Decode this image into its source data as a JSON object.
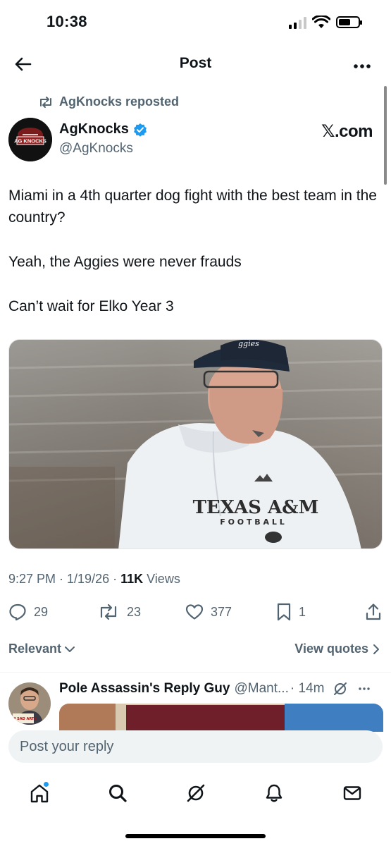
{
  "status_bar": {
    "time": "10:38"
  },
  "header": {
    "title": "Post",
    "more_icon": "more-icon"
  },
  "repost": {
    "text": "AgKnocks reposted"
  },
  "author": {
    "name": "AgKnocks",
    "handle": "@AgKnocks",
    "verified": true,
    "avatar_text": "AG KNOCKS",
    "source_label": "𝕏.com"
  },
  "post": {
    "paragraphs": [
      "Miami in a 4th quarter dog fight with the best team in the country?",
      "Yeah, the Aggies were never frauds",
      "Can’t wait for Elko Year 3"
    ],
    "image": {
      "shirt_line1": "TEXAS A&M",
      "shirt_line2": "F O O T B A L L"
    }
  },
  "meta": {
    "time_date": "9:27 PM · 1/19/26 · ",
    "views_count": "11K",
    "views_label": " Views"
  },
  "actions": {
    "replies": "29",
    "reposts": "23",
    "likes": "377",
    "bookmarks": "1"
  },
  "sort": {
    "label": "Relevant",
    "view_quotes": "View quotes"
  },
  "reply": {
    "name": "Pole Assassin's Reply Guy",
    "handle": "@Mant...",
    "time": "· 14m",
    "avatar_caption": "I'M SAD ARTY"
  },
  "composer": {
    "placeholder": "Post your reply"
  },
  "colors": {
    "accent": "#1d9bf0",
    "text": "#0f1419",
    "secondary": "#536471"
  }
}
